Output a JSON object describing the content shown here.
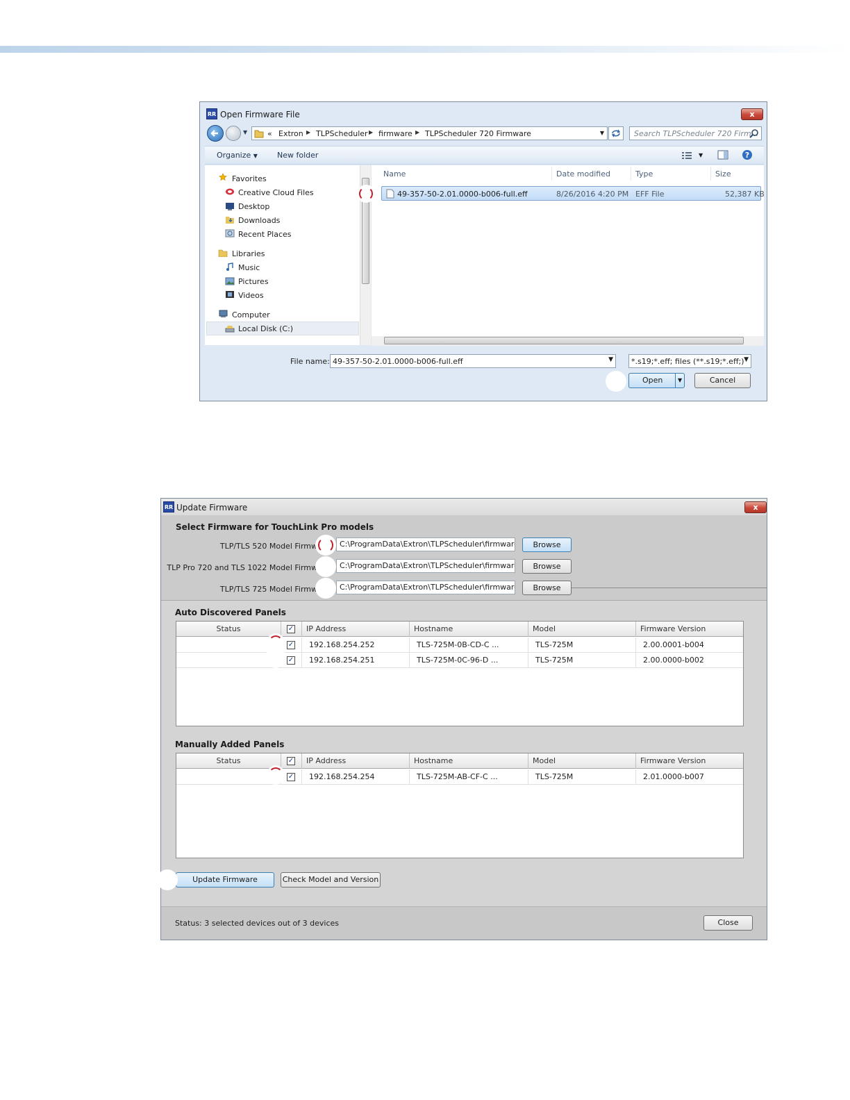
{
  "open_dialog": {
    "title": "Open Firmware File",
    "breadcrumb": [
      "«",
      "Extron",
      "TLPScheduler",
      "firmware",
      "TLPScheduler 720 Firmware"
    ],
    "search_placeholder": "Search TLPScheduler 720 Firm...",
    "toolbar": {
      "organize": "Organize",
      "new_folder": "New folder"
    },
    "nav": {
      "favorites": "Favorites",
      "favorites_items": [
        "Creative Cloud Files",
        "Desktop",
        "Downloads",
        "Recent Places"
      ],
      "libraries": "Libraries",
      "libraries_items": [
        "Music",
        "Pictures",
        "Videos"
      ],
      "computer": "Computer",
      "computer_items": [
        "Local Disk (C:)"
      ]
    },
    "columns": [
      "Name",
      "Date modified",
      "Type",
      "Size"
    ],
    "files": [
      {
        "name": "49-357-50-2.01.0000-b006-full.eff",
        "date": "8/26/2016 4:20 PM",
        "type": "EFF File",
        "size": "52,387 KB"
      }
    ],
    "file_name_label": "File name:",
    "file_name_value": "49-357-50-2.01.0000-b006-full.eff",
    "file_type_value": "*.s19;*.eff; files (**.s19;*.eff;)",
    "open_label": "Open",
    "cancel_label": "Cancel"
  },
  "update_dialog": {
    "title": "Update Firmware",
    "select_title": "Select Firmware for TouchLink Pro models",
    "firmware_rows": [
      {
        "label": "TLP/TLS 520 Model Firmw",
        "path": "C:\\ProgramData\\Extron\\TLPScheduler\\firmware\\TI",
        "button": "Browse"
      },
      {
        "label": "TLP Pro 720 and TLS 1022 Model Firmw",
        "path": "C:\\ProgramData\\Extron\\TLPScheduler\\firmware\\TI",
        "button": "Browse"
      },
      {
        "label": "TLP/TLS 725 Model Firmw",
        "path": "C:\\ProgramData\\Extron\\TLPScheduler\\firmware\\TI",
        "button": "Browse"
      }
    ],
    "auto_title": "Auto Discovered Panels",
    "manual_title": "Manually Added Panels",
    "columns": [
      "Status",
      "IP Address",
      "Hostname",
      "Model",
      "Firmware Version"
    ],
    "auto_rows": [
      {
        "ip": "192.168.254.252",
        "host": "TLS-725M-0B-CD-C ...",
        "model": "TLS-725M",
        "fw": "2.00.0001-b004"
      },
      {
        "ip": "192.168.254.251",
        "host": "TLS-725M-0C-96-D ...",
        "model": "TLS-725M",
        "fw": "2.00.0000-b002"
      }
    ],
    "manual_rows": [
      {
        "ip": "192.168.254.254",
        "host": "TLS-725M-AB-CF-C ...",
        "model": "TLS-725M",
        "fw": "2.01.0000-b007"
      }
    ],
    "update_button": "Update Firmware",
    "check_button": "Check Model and Version",
    "status_text": "Status: 3 selected devices out of 3 devices",
    "close_button": "Close"
  },
  "glyphs": {
    "check": "✓",
    "close_x": "x",
    "dropdown": "▼",
    "crumb_arrow": "▶"
  },
  "colors": {
    "selection": "#c2dcf7",
    "marker_accent": "#c0202a",
    "star": "#f2b600"
  }
}
